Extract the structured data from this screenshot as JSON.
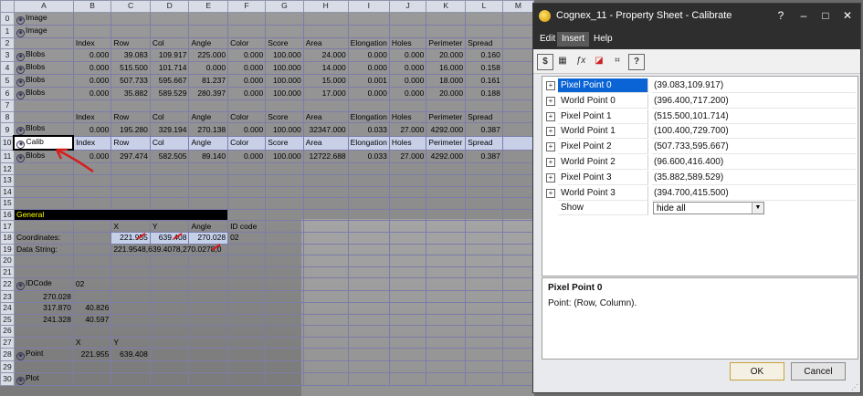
{
  "sheet": {
    "columns": [
      "A",
      "B",
      "C",
      "D",
      "E",
      "F",
      "G",
      "H",
      "I",
      "J",
      "K",
      "L",
      "M"
    ],
    "rows": [
      {
        "n": "0",
        "cells": [
          {
            "c": "A",
            "t": "Image",
            "icon": true
          }
        ]
      },
      {
        "n": "1",
        "cells": [
          {
            "c": "A",
            "t": "Image",
            "icon": true
          }
        ]
      },
      {
        "n": "2",
        "cells": [
          {
            "c": "B",
            "t": "Index"
          },
          {
            "c": "C",
            "t": "Row"
          },
          {
            "c": "D",
            "t": "Col"
          },
          {
            "c": "E",
            "t": "Angle"
          },
          {
            "c": "F",
            "t": "Color"
          },
          {
            "c": "G",
            "t": "Score"
          },
          {
            "c": "H",
            "t": "Area"
          },
          {
            "c": "I",
            "t": "Elongation"
          },
          {
            "c": "J",
            "t": "Holes"
          },
          {
            "c": "K",
            "t": "Perimeter"
          },
          {
            "c": "L",
            "t": "Spread"
          }
        ]
      },
      {
        "n": "3",
        "cells": [
          {
            "c": "A",
            "t": "Blobs",
            "icon": true
          },
          {
            "c": "B",
            "t": "0.000",
            "num": true
          },
          {
            "c": "C",
            "t": "39.083",
            "num": true
          },
          {
            "c": "D",
            "t": "109.917",
            "num": true
          },
          {
            "c": "E",
            "t": "225.000",
            "num": true
          },
          {
            "c": "F",
            "t": "0.000",
            "num": true
          },
          {
            "c": "G",
            "t": "100.000",
            "num": true
          },
          {
            "c": "H",
            "t": "24.000",
            "num": true
          },
          {
            "c": "I",
            "t": "0.000",
            "num": true
          },
          {
            "c": "J",
            "t": "0.000",
            "num": true
          },
          {
            "c": "K",
            "t": "20.000",
            "num": true
          },
          {
            "c": "L",
            "t": "0.160",
            "num": true
          }
        ]
      },
      {
        "n": "4",
        "cells": [
          {
            "c": "A",
            "t": "Blobs",
            "icon": true
          },
          {
            "c": "B",
            "t": "0.000",
            "num": true
          },
          {
            "c": "C",
            "t": "515.500",
            "num": true
          },
          {
            "c": "D",
            "t": "101.714",
            "num": true
          },
          {
            "c": "E",
            "t": "0.000",
            "num": true
          },
          {
            "c": "F",
            "t": "0.000",
            "num": true
          },
          {
            "c": "G",
            "t": "100.000",
            "num": true
          },
          {
            "c": "H",
            "t": "14.000",
            "num": true
          },
          {
            "c": "I",
            "t": "0.000",
            "num": true
          },
          {
            "c": "J",
            "t": "0.000",
            "num": true
          },
          {
            "c": "K",
            "t": "16.000",
            "num": true
          },
          {
            "c": "L",
            "t": "0.158",
            "num": true
          }
        ]
      },
      {
        "n": "5",
        "cells": [
          {
            "c": "A",
            "t": "Blobs",
            "icon": true
          },
          {
            "c": "B",
            "t": "0.000",
            "num": true
          },
          {
            "c": "C",
            "t": "507.733",
            "num": true
          },
          {
            "c": "D",
            "t": "595.667",
            "num": true
          },
          {
            "c": "E",
            "t": "81.237",
            "num": true
          },
          {
            "c": "F",
            "t": "0.000",
            "num": true
          },
          {
            "c": "G",
            "t": "100.000",
            "num": true
          },
          {
            "c": "H",
            "t": "15.000",
            "num": true
          },
          {
            "c": "I",
            "t": "0.001",
            "num": true
          },
          {
            "c": "J",
            "t": "0.000",
            "num": true
          },
          {
            "c": "K",
            "t": "18.000",
            "num": true
          },
          {
            "c": "L",
            "t": "0.161",
            "num": true
          }
        ]
      },
      {
        "n": "6",
        "cells": [
          {
            "c": "A",
            "t": "Blobs",
            "icon": true
          },
          {
            "c": "B",
            "t": "0.000",
            "num": true
          },
          {
            "c": "C",
            "t": "35.882",
            "num": true
          },
          {
            "c": "D",
            "t": "589.529",
            "num": true
          },
          {
            "c": "E",
            "t": "280.397",
            "num": true
          },
          {
            "c": "F",
            "t": "0.000",
            "num": true
          },
          {
            "c": "G",
            "t": "100.000",
            "num": true
          },
          {
            "c": "H",
            "t": "17.000",
            "num": true
          },
          {
            "c": "I",
            "t": "0.000",
            "num": true
          },
          {
            "c": "J",
            "t": "0.000",
            "num": true
          },
          {
            "c": "K",
            "t": "20.000",
            "num": true
          },
          {
            "c": "L",
            "t": "0.188",
            "num": true
          }
        ]
      },
      {
        "n": "7",
        "cells": []
      },
      {
        "n": "8",
        "cells": [
          {
            "c": "B",
            "t": "Index"
          },
          {
            "c": "C",
            "t": "Row"
          },
          {
            "c": "D",
            "t": "Col"
          },
          {
            "c": "E",
            "t": "Angle"
          },
          {
            "c": "F",
            "t": "Color"
          },
          {
            "c": "G",
            "t": "Score"
          },
          {
            "c": "H",
            "t": "Area"
          },
          {
            "c": "I",
            "t": "Elongation"
          },
          {
            "c": "J",
            "t": "Holes"
          },
          {
            "c": "K",
            "t": "Perimeter"
          },
          {
            "c": "L",
            "t": "Spread"
          }
        ]
      },
      {
        "n": "9",
        "cells": [
          {
            "c": "A",
            "t": "Blobs",
            "icon": true
          },
          {
            "c": "B",
            "t": "0.000",
            "num": true
          },
          {
            "c": "C",
            "t": "195.280",
            "num": true
          },
          {
            "c": "D",
            "t": "329.194",
            "num": true
          },
          {
            "c": "E",
            "t": "270.138",
            "num": true
          },
          {
            "c": "F",
            "t": "0.000",
            "num": true
          },
          {
            "c": "G",
            "t": "100.000",
            "num": true
          },
          {
            "c": "H",
            "t": "32347.000",
            "num": true
          },
          {
            "c": "I",
            "t": "0.033",
            "num": true
          },
          {
            "c": "J",
            "t": "27.000",
            "num": true
          },
          {
            "c": "K",
            "t": "4292.000",
            "num": true
          },
          {
            "c": "L",
            "t": "0.387",
            "num": true
          }
        ]
      },
      {
        "n": "10",
        "sel": true,
        "cells": [
          {
            "c": "A",
            "t": "Calib",
            "icon": true,
            "selcell": true
          },
          {
            "c": "B",
            "t": "Index"
          },
          {
            "c": "C",
            "t": "Row"
          },
          {
            "c": "D",
            "t": "Col"
          },
          {
            "c": "E",
            "t": "Angle"
          },
          {
            "c": "F",
            "t": "Color"
          },
          {
            "c": "G",
            "t": "Score"
          },
          {
            "c": "H",
            "t": "Area"
          },
          {
            "c": "I",
            "t": "Elongation"
          },
          {
            "c": "J",
            "t": "Holes"
          },
          {
            "c": "K",
            "t": "Perimeter"
          },
          {
            "c": "L",
            "t": "Spread"
          }
        ]
      },
      {
        "n": "11",
        "cells": [
          {
            "c": "A",
            "t": "Blobs",
            "icon": true
          },
          {
            "c": "B",
            "t": "0.000",
            "num": true
          },
          {
            "c": "C",
            "t": "297.474",
            "num": true
          },
          {
            "c": "D",
            "t": "582.505",
            "num": true
          },
          {
            "c": "E",
            "t": "89.140",
            "num": true
          },
          {
            "c": "F",
            "t": "0.000",
            "num": true
          },
          {
            "c": "G",
            "t": "100.000",
            "num": true
          },
          {
            "c": "H",
            "t": "12722.688",
            "num": true
          },
          {
            "c": "I",
            "t": "0.033",
            "num": true
          },
          {
            "c": "J",
            "t": "27.000",
            "num": true
          },
          {
            "c": "K",
            "t": "4292.000",
            "num": true
          },
          {
            "c": "L",
            "t": "0.387",
            "num": true
          }
        ]
      },
      {
        "n": "12",
        "cells": []
      },
      {
        "n": "13",
        "cells": []
      },
      {
        "n": "14",
        "cells": []
      },
      {
        "n": "15",
        "cells": []
      },
      {
        "n": "16",
        "cells": [
          {
            "c": "A",
            "t": "General",
            "black": true,
            "span": 5
          }
        ]
      },
      {
        "n": "17",
        "cells": [
          {
            "c": "C",
            "t": "X"
          },
          {
            "c": "D",
            "t": "Y"
          },
          {
            "c": "E",
            "t": "Angle"
          },
          {
            "c": "F",
            "t": "ID code"
          }
        ]
      },
      {
        "n": "18",
        "cells": [
          {
            "c": "A",
            "t": "Coordinates:"
          },
          {
            "c": "C",
            "t": "221.955",
            "num": true,
            "hl": true
          },
          {
            "c": "D",
            "t": "639.408",
            "num": true,
            "hl": true
          },
          {
            "c": "E",
            "t": "270.028",
            "num": true,
            "hl": true
          },
          {
            "c": "F",
            "t": "02"
          }
        ]
      },
      {
        "n": "19",
        "cells": [
          {
            "c": "A",
            "t": "Data String:"
          },
          {
            "c": "C",
            "t": "221.9548,639.4078,270.0278,0",
            "span": 3
          }
        ]
      },
      {
        "n": "20",
        "cells": []
      },
      {
        "n": "21",
        "cells": []
      },
      {
        "n": "22",
        "cells": [
          {
            "c": "A",
            "t": "IDCode",
            "icon": true
          },
          {
            "c": "B",
            "t": "02"
          }
        ]
      },
      {
        "n": "23",
        "cells": [
          {
            "c": "A",
            "t": "270.028",
            "num": true
          }
        ]
      },
      {
        "n": "24",
        "cells": [
          {
            "c": "A",
            "t": "317.870",
            "num": true
          },
          {
            "c": "B",
            "t": "40.826",
            "num": true
          }
        ]
      },
      {
        "n": "25",
        "cells": [
          {
            "c": "A",
            "t": "241.328",
            "num": true
          },
          {
            "c": "B",
            "t": "40.597",
            "num": true
          }
        ]
      },
      {
        "n": "26",
        "cells": []
      },
      {
        "n": "27",
        "cells": [
          {
            "c": "B",
            "t": "X"
          },
          {
            "c": "C",
            "t": "Y"
          }
        ]
      },
      {
        "n": "28",
        "cells": [
          {
            "c": "A",
            "t": "Point",
            "icon": true
          },
          {
            "c": "B",
            "t": "221.955",
            "num": true
          },
          {
            "c": "C",
            "t": "639.408",
            "num": true
          }
        ]
      },
      {
        "n": "29",
        "cells": []
      },
      {
        "n": "30",
        "cells": [
          {
            "c": "A",
            "t": "Plot",
            "icon": true
          }
        ]
      }
    ]
  },
  "dialog": {
    "title": "Cognex_11 - Property Sheet - Calibrate",
    "title_buttons": {
      "help": "?",
      "minimize": "–",
      "maximize": "□",
      "close": "✕"
    },
    "menu": [
      "Edit",
      "Insert",
      "Help"
    ],
    "active_menu": "Insert",
    "toolbar_icons": [
      "dollar-format-icon",
      "table-icon",
      "function-icon",
      "bookmark-icon",
      "crosshair-icon",
      "help-icon"
    ],
    "toolbar_glyphs": [
      "$",
      "▦",
      "ƒx",
      "◪",
      "⌗",
      "?"
    ],
    "properties": [
      {
        "name": "Pixel Point 0",
        "value": "(39.083,109.917)",
        "selected": true
      },
      {
        "name": "World Point 0",
        "value": "(396.400,717.200)"
      },
      {
        "name": "Pixel Point 1",
        "value": "(515.500,101.714)"
      },
      {
        "name": "World Point 1",
        "value": "(100.400,729.700)"
      },
      {
        "name": "Pixel Point 2",
        "value": "(507.733,595.667)"
      },
      {
        "name": "World Point 2",
        "value": "(96.600,416.400)"
      },
      {
        "name": "Pixel Point 3",
        "value": "(35.882,589.529)"
      },
      {
        "name": "World Point 3",
        "value": "(394.700,415.500)"
      }
    ],
    "show_label": "Show",
    "show_value": "hide all",
    "description_title": "Pixel Point 0",
    "description_text": "Point: (Row, Column).",
    "ok_label": "OK",
    "cancel_label": "Cancel"
  },
  "colors": {
    "annotation_red": "#d81d1d",
    "selection_blue": "#0a64d6",
    "title_bar": "#2e2e2e"
  }
}
